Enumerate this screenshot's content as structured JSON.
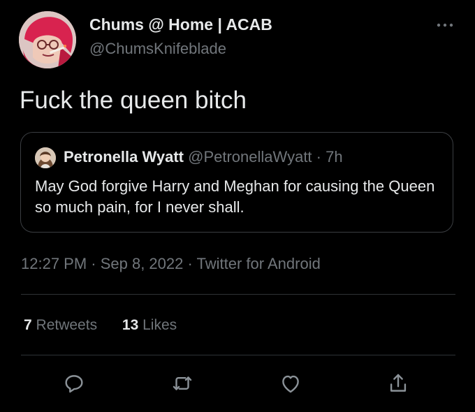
{
  "author": {
    "name": "Chums @ Home | ACAB",
    "handle": "@ChumsKnifeblade"
  },
  "tweet": {
    "text": "Fuck the queen bitch"
  },
  "quoted": {
    "name": "Petronella Wyatt",
    "handle": "@PetronellaWyatt",
    "separator": "·",
    "time": "7h",
    "text": "May God forgive Harry and Meghan for causing the Queen so much pain, for I never shall."
  },
  "meta": {
    "line": "12:27 PM · Sep 8, 2022 · Twitter for Android"
  },
  "stats": {
    "retweets_count": "7",
    "retweets_label": "Retweets",
    "likes_count": "13",
    "likes_label": "Likes"
  },
  "icons": {
    "more": "more-icon",
    "reply": "reply-icon",
    "retweet": "retweet-icon",
    "like": "like-icon",
    "share": "share-icon"
  },
  "colors": {
    "background": "#000000",
    "text": "#e7e9ea",
    "secondary": "#71767b",
    "border": "#2f3336"
  }
}
